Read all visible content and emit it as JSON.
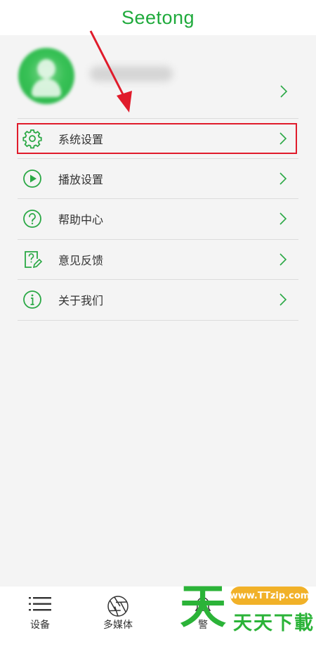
{
  "header": {
    "title": "Seetong"
  },
  "profile": {
    "avatar_icon": "user-avatar-icon",
    "chevron_icon": "chevron-right-icon"
  },
  "menu": {
    "items": [
      {
        "label": "系统设置",
        "icon": "gear-icon"
      },
      {
        "label": "播放设置",
        "icon": "play-circle-icon"
      },
      {
        "label": "帮助中心",
        "icon": "help-circle-icon"
      },
      {
        "label": "意见反馈",
        "icon": "feedback-edit-icon"
      },
      {
        "label": "关于我们",
        "icon": "info-circle-icon"
      }
    ]
  },
  "tabbar": {
    "tabs": [
      {
        "label": "设备",
        "icon": "list-icon"
      },
      {
        "label": "多媒体",
        "icon": "aperture-icon"
      },
      {
        "label": "警",
        "icon": "alarm-icon"
      }
    ]
  },
  "watermark": {
    "big_char": "天",
    "url": "www.TTzip.com",
    "name": "天天下載"
  },
  "colors": {
    "accent": "#1faa3c",
    "highlight": "#e01b2b",
    "background": "#f4f4f4"
  }
}
